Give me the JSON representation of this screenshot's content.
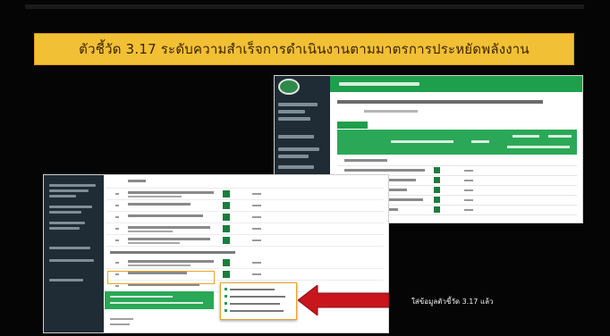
{
  "slide": {
    "title": "ตัวชี้วัด 3.17 ระดับความสำเร็จการดำเนินงานตามมาตรการประหยัดพลังงาน",
    "caption": "ใส่ข้อมูลตัวชี้วัด 3.17 แล้ว"
  },
  "colors": {
    "banner": "#f2c034",
    "app_green": "#1e9f4c",
    "sidebar": "#1f2b35",
    "arrow": "#c8161c",
    "highlight": "#e6a42b"
  },
  "icons": {
    "arrow": "left-pointing-red-arrow-icon",
    "logo": "ministry-logo-icon"
  }
}
